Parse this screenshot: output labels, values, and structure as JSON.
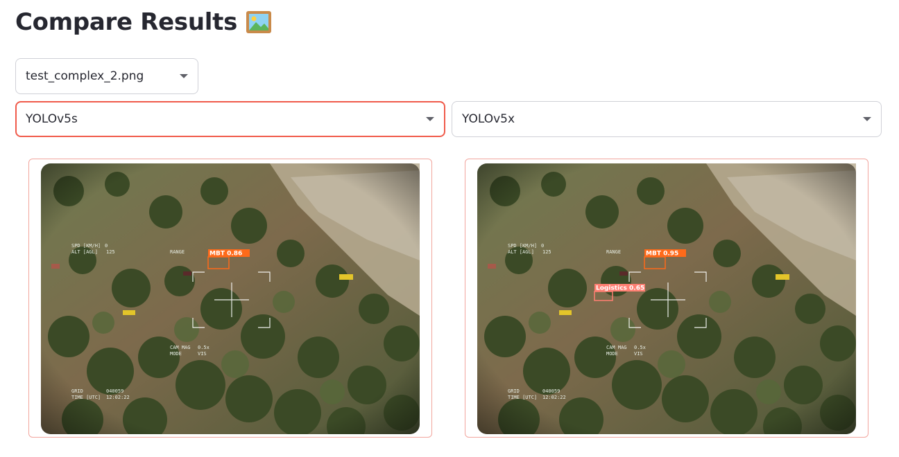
{
  "page": {
    "title": "Compare Results",
    "title_icon": "framed-picture-icon"
  },
  "file_select": {
    "value": "test_complex_2.png",
    "icon": "chevron-down-icon"
  },
  "model_left_select": {
    "value": "YOLOv5s",
    "focused": true,
    "accent_color": "#f05a4a"
  },
  "model_right_select": {
    "value": "YOLOv5x"
  },
  "hud": {
    "spd_label": "SPD [KM/H]",
    "spd_value": "0",
    "alt_label": "ALT [AGL]",
    "alt_value": "125",
    "range_label": "RANGE",
    "cam_mag_label": "CAM MAG",
    "cam_mag_value": "0.5x",
    "mode_label": "MODE",
    "mode_value": "VIS",
    "grid_label": "GRID",
    "grid_value": "040059",
    "time_label": "TIME [UTC]",
    "time_value": "12:02:22"
  },
  "results": {
    "left": {
      "detections": [
        {
          "label": "MBT 0.86",
          "color": "#ff6a1a"
        }
      ]
    },
    "right": {
      "detections": [
        {
          "label": "MBT 0.95",
          "color": "#ff6a1a"
        },
        {
          "label": "Logistics 0.65",
          "color": "#ff7f72"
        }
      ]
    }
  },
  "colors": {
    "panel_border": "#f2a59d",
    "select_border": "#cfd0d6",
    "text": "#262730"
  }
}
